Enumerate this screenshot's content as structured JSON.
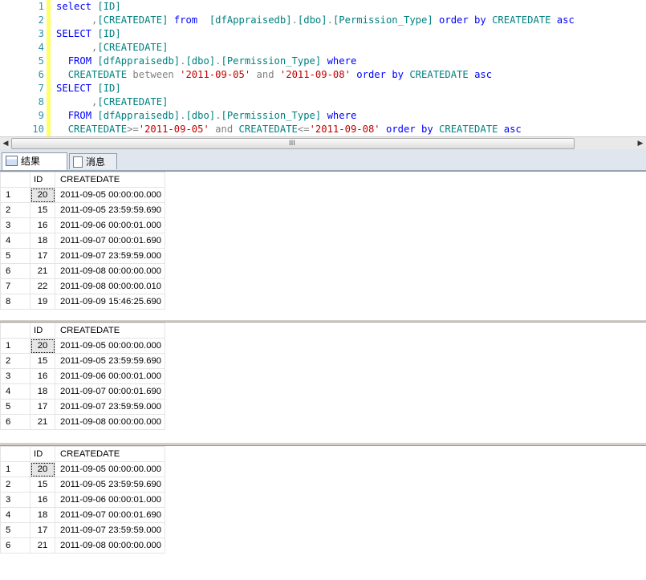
{
  "editor": {
    "lines": [
      {
        "n": "1",
        "html": "<span class='kw'>select</span> <span class='obj'>[ID]</span>"
      },
      {
        "n": "2",
        "html": "      <span class='gray'>,</span><span class='obj'>[CREATEDATE]</span> <span class='kw'>from</span>  <span class='obj'>[dfAppraisedb]</span><span class='gray'>.</span><span class='obj'>[dbo]</span><span class='gray'>.</span><span class='obj'>[Permission_Type]</span> <span class='kw'>order by</span> <span class='obj'>CREATEDATE</span> <span class='kw'>asc</span>"
      },
      {
        "n": "3",
        "html": "<span class='kw'>SELECT</span> <span class='obj'>[ID]</span>"
      },
      {
        "n": "4",
        "html": "      <span class='gray'>,</span><span class='obj'>[CREATEDATE]</span>"
      },
      {
        "n": "5",
        "html": "  <span class='kw'>FROM</span> <span class='obj'>[dfAppraisedb]</span><span class='gray'>.</span><span class='obj'>[dbo]</span><span class='gray'>.</span><span class='obj'>[Permission_Type]</span> <span class='kw'>where</span>"
      },
      {
        "n": "6",
        "html": "  <span class='obj'>CREATEDATE</span> <span class='gray'>between</span> <span class='str'>'2011-09-05'</span> <span class='gray'>and</span> <span class='str'>'2011-09-08'</span> <span class='kw'>order by</span> <span class='obj'>CREATEDATE</span> <span class='kw'>asc</span>"
      },
      {
        "n": "7",
        "html": "<span class='kw'>SELECT</span> <span class='obj'>[ID]</span>"
      },
      {
        "n": "8",
        "html": "      <span class='gray'>,</span><span class='obj'>[CREATEDATE]</span>"
      },
      {
        "n": "9",
        "html": "  <span class='kw'>FROM</span> <span class='obj'>[dfAppraisedb]</span><span class='gray'>.</span><span class='obj'>[dbo]</span><span class='gray'>.</span><span class='obj'>[Permission_Type]</span> <span class='kw'>where</span>"
      },
      {
        "n": "10",
        "html": "  <span class='obj'>CREATEDATE</span><span class='gray'>&gt;=</span><span class='str'>'2011-09-05'</span> <span class='gray'>and</span> <span class='obj'>CREATEDATE</span><span class='gray'>&lt;=</span><span class='str'>'2011-09-08'</span> <span class='kw'>order by</span> <span class='obj'>CREATEDATE</span> <span class='kw'>asc</span>"
      }
    ]
  },
  "scrollbar": {
    "left_icon": "chevron-left-icon",
    "right_icon": "chevron-right-icon",
    "grip": "III"
  },
  "tabs": [
    {
      "label": "结果",
      "icon": "grid-icon"
    },
    {
      "label": "消息",
      "icon": "document-icon"
    }
  ],
  "grids": [
    {
      "headers": [
        "ID",
        "CREATEDATE"
      ],
      "rows": [
        [
          "1",
          "20",
          "2011-09-05 00:00:00.000"
        ],
        [
          "2",
          "15",
          "2011-09-05 23:59:59.690"
        ],
        [
          "3",
          "16",
          "2011-09-06 00:00:01.000"
        ],
        [
          "4",
          "18",
          "2011-09-07 00:00:01.690"
        ],
        [
          "5",
          "17",
          "2011-09-07 23:59:59.000"
        ],
        [
          "6",
          "21",
          "2011-09-08 00:00:00.000"
        ],
        [
          "7",
          "22",
          "2011-09-08 00:00:00.010"
        ],
        [
          "8",
          "19",
          "2011-09-09 15:46:25.690"
        ]
      ]
    },
    {
      "headers": [
        "ID",
        "CREATEDATE"
      ],
      "rows": [
        [
          "1",
          "20",
          "2011-09-05 00:00:00.000"
        ],
        [
          "2",
          "15",
          "2011-09-05 23:59:59.690"
        ],
        [
          "3",
          "16",
          "2011-09-06 00:00:01.000"
        ],
        [
          "4",
          "18",
          "2011-09-07 00:00:01.690"
        ],
        [
          "5",
          "17",
          "2011-09-07 23:59:59.000"
        ],
        [
          "6",
          "21",
          "2011-09-08 00:00:00.000"
        ]
      ]
    },
    {
      "headers": [
        "ID",
        "CREATEDATE"
      ],
      "rows": [
        [
          "1",
          "20",
          "2011-09-05 00:00:00.000"
        ],
        [
          "2",
          "15",
          "2011-09-05 23:59:59.690"
        ],
        [
          "3",
          "16",
          "2011-09-06 00:00:01.000"
        ],
        [
          "4",
          "18",
          "2011-09-07 00:00:01.690"
        ],
        [
          "5",
          "17",
          "2011-09-07 23:59:59.000"
        ],
        [
          "6",
          "21",
          "2011-09-08 00:00:00.000"
        ]
      ]
    }
  ]
}
